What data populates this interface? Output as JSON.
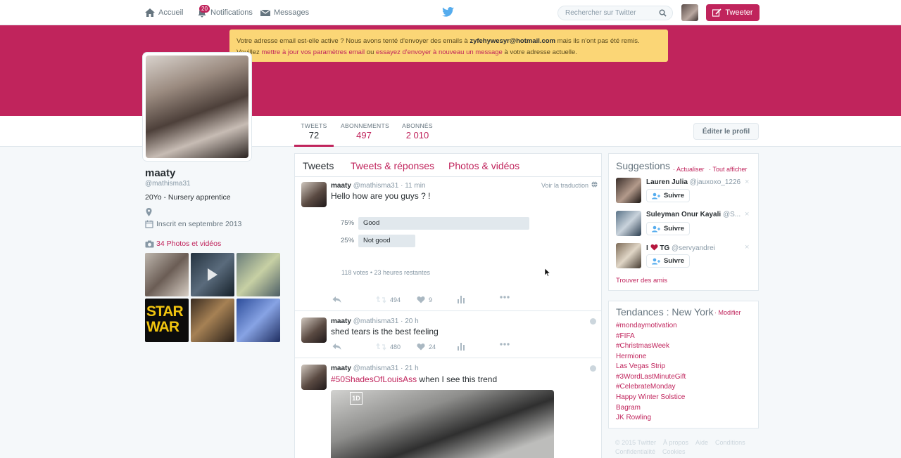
{
  "nav": {
    "home": "Accueil",
    "notifications": "Notifications",
    "notif_count": "20",
    "messages": "Messages",
    "search_placeholder": "Rechercher sur Twitter",
    "tweet_button": "Tweeter"
  },
  "alert": {
    "line1_a": "Votre adresse email est-elle active ? Nous avons tenté d'envoyer des emails à ",
    "email": "zyfehywesyr@hotmail.com",
    "line1_b": " mais ils n'ont pas été remis.",
    "line2_a": "Veuillez ",
    "link1": "mettre à jour vos paramètres email",
    "line2_b": " ou ",
    "link2": "essayez d'envoyer à nouveau un message",
    "line2_c": " à votre adresse actuelle."
  },
  "stats": {
    "tweets_label": "TWEETS",
    "tweets": "72",
    "following_label": "ABONNEMENTS",
    "following": "497",
    "followers_label": "ABONNÉS",
    "followers": "2 010",
    "edit_profile": "Éditer le profil"
  },
  "profile": {
    "name": "maaty",
    "handle": "@mathisma31",
    "bio": "20Yo - Nursery apprentice",
    "joined": "Inscrit en septembre 2013",
    "photos_link": "34 Photos et vidéos",
    "thumb4_text": "STAR WAR"
  },
  "tabs": {
    "tweets": "Tweets",
    "replies": "Tweets & réponses",
    "media": "Photos & vidéos"
  },
  "tweets": [
    {
      "name": "maaty",
      "handle": "@mathisma31",
      "time": "· 11 min",
      "text": "Hello how are you guys ? !",
      "translate": "Voir la traduction",
      "poll": [
        {
          "pct": "75%",
          "label": "Good",
          "fraction": 0.75
        },
        {
          "pct": "25%",
          "label": "Not good",
          "fraction": 0.25
        }
      ],
      "poll_meta": "118 votes • 23 heures restantes",
      "retweets": "494",
      "likes": "9"
    },
    {
      "name": "maaty",
      "handle": "@mathisma31",
      "time": "· 20 h",
      "text": "shed tears is the best feeling",
      "retweets": "480",
      "likes": "24"
    },
    {
      "name": "maaty",
      "handle": "@mathisma31",
      "time": "· 21 h",
      "hashtag": "#50ShadesOfLouisAss",
      "text": " when I see this trend",
      "media_badge": "1D"
    }
  ],
  "suggestions": {
    "title": "Suggestions",
    "refresh": "· Actualiser",
    "view_all": "· Tout afficher",
    "follow": "Suivre",
    "find_friends": "Trouver des amis",
    "close": "×",
    "users": [
      {
        "name": "Lauren Julia",
        "handle": "@jauxoxo_1226"
      },
      {
        "name": "Suleyman Onur Kayali",
        "handle": "@S..."
      },
      {
        "name_prefix": "I",
        "name": "TG",
        "handle": "@servyandrei"
      }
    ]
  },
  "trends": {
    "title": "Tendances : New York",
    "modify": "· Modifier",
    "items": [
      "#mondaymotivation",
      "#FIFA",
      "#ChristmasWeek",
      "Hermione",
      "Las Vegas Strip",
      "#3WordLastMinuteGift",
      "#CelebrateMonday",
      "Happy Winter Solstice",
      "Bagram",
      "JK Rowling"
    ]
  },
  "footer": {
    "items": [
      "© 2015 Twitter",
      "À propos",
      "Aide",
      "Conditions",
      "Confidentialité",
      "Cookies"
    ]
  }
}
